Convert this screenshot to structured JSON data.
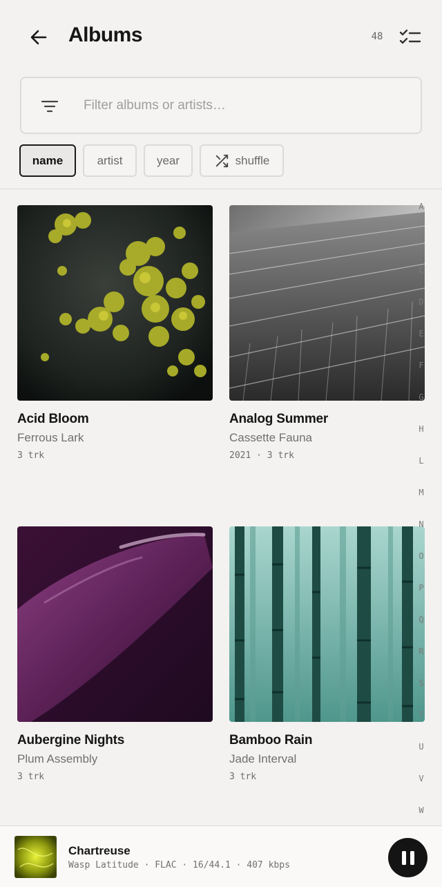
{
  "header": {
    "title": "Albums",
    "count": "48",
    "back_icon": "arrow-left-icon",
    "select_icon": "checklist-icon"
  },
  "search": {
    "placeholder": "Filter albums or artists…",
    "value": "",
    "icon": "filter-icon"
  },
  "sort_chips": [
    {
      "label": "name",
      "active": true
    },
    {
      "label": "artist",
      "active": false
    },
    {
      "label": "year",
      "active": false
    },
    {
      "label": "shuffle",
      "active": false,
      "icon": "shuffle-icon"
    }
  ],
  "albums": [
    {
      "title": "Acid Bloom",
      "artist": "Ferrous Lark",
      "meta": "3 trk"
    },
    {
      "title": "Analog Summer",
      "artist": "Cassette Fauna",
      "meta": "2021 · 3 trk"
    },
    {
      "title": "Aubergine Nights",
      "artist": "Plum Assembly",
      "meta": "3 trk"
    },
    {
      "title": "Bamboo Rain",
      "artist": "Jade Interval",
      "meta": "3 trk"
    }
  ],
  "alphabet_index": [
    "A",
    "B",
    "C",
    "D",
    "E",
    "F",
    "G",
    "H",
    "L",
    "M",
    "N",
    "O",
    "P",
    "Q",
    "R",
    "S",
    "T",
    "U",
    "V",
    "W"
  ],
  "now_playing": {
    "track": "Chartreuse",
    "info": "Wasp Latitude · FLAC · 16/44.1 · 407 kbps",
    "control_icon": "pause-icon"
  },
  "colors": {
    "background": "#f3f2f0",
    "text": "#1b1b1b",
    "accent": "#141414"
  }
}
